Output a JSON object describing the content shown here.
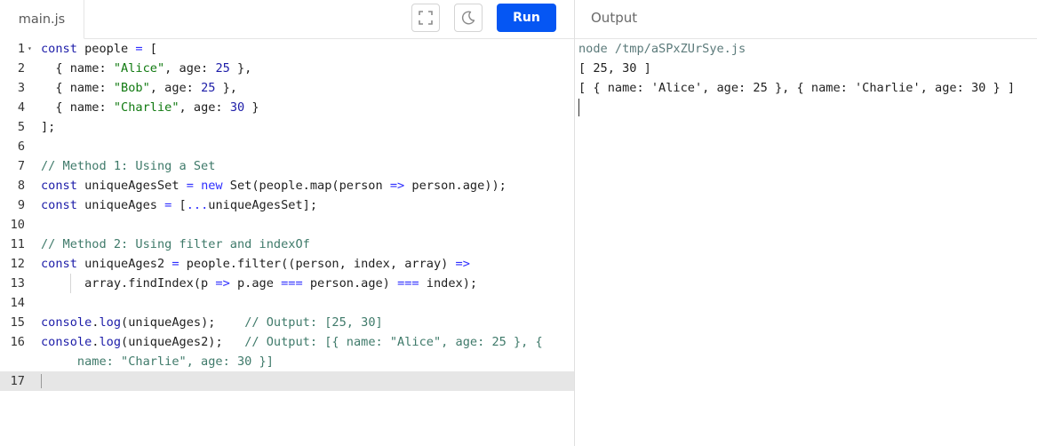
{
  "editor": {
    "file_tab": "main.js",
    "run_label": "Run",
    "icons": {
      "fullscreen": "fullscreen-icon",
      "theme": "moon-icon"
    }
  },
  "code_lines": [
    {
      "n": "1",
      "fold": true,
      "tokens": [
        [
          "kw",
          "const"
        ],
        [
          "punc",
          " people "
        ],
        [
          "op",
          "="
        ],
        [
          "punc",
          " ["
        ]
      ]
    },
    {
      "n": "2",
      "tokens": [
        [
          "punc",
          "  { name: "
        ],
        [
          "str",
          "\"Alice\""
        ],
        [
          "punc",
          ", age: "
        ],
        [
          "num",
          "25"
        ],
        [
          "punc",
          " },"
        ]
      ]
    },
    {
      "n": "3",
      "tokens": [
        [
          "punc",
          "  { name: "
        ],
        [
          "str",
          "\"Bob\""
        ],
        [
          "punc",
          ", age: "
        ],
        [
          "num",
          "25"
        ],
        [
          "punc",
          " },"
        ]
      ]
    },
    {
      "n": "4",
      "tokens": [
        [
          "punc",
          "  { name: "
        ],
        [
          "str",
          "\"Charlie\""
        ],
        [
          "punc",
          ", age: "
        ],
        [
          "num",
          "30"
        ],
        [
          "punc",
          " }"
        ]
      ]
    },
    {
      "n": "5",
      "tokens": [
        [
          "punc",
          "];"
        ]
      ]
    },
    {
      "n": "6",
      "tokens": []
    },
    {
      "n": "7",
      "tokens": [
        [
          "cmt",
          "// Method 1: Using a Set"
        ]
      ]
    },
    {
      "n": "8",
      "tokens": [
        [
          "kw",
          "const"
        ],
        [
          "punc",
          " uniqueAgesSet "
        ],
        [
          "op",
          "="
        ],
        [
          "punc",
          " "
        ],
        [
          "kwb",
          "new"
        ],
        [
          "punc",
          " Set(people.map(person "
        ],
        [
          "op",
          "=>"
        ],
        [
          "punc",
          " person.age));"
        ]
      ]
    },
    {
      "n": "9",
      "tokens": [
        [
          "kw",
          "const"
        ],
        [
          "punc",
          " uniqueAges "
        ],
        [
          "op",
          "="
        ],
        [
          "punc",
          " ["
        ],
        [
          "op",
          "..."
        ],
        [
          "punc",
          "uniqueAgesSet];"
        ]
      ]
    },
    {
      "n": "10",
      "tokens": []
    },
    {
      "n": "11",
      "tokens": [
        [
          "cmt",
          "// Method 2: Using filter and indexOf"
        ]
      ]
    },
    {
      "n": "12",
      "tokens": [
        [
          "kw",
          "const"
        ],
        [
          "punc",
          " uniqueAges2 "
        ],
        [
          "op",
          "="
        ],
        [
          "punc",
          " people.filter((person, index, array) "
        ],
        [
          "op",
          "=>"
        ]
      ]
    },
    {
      "n": "13",
      "guide": true,
      "tokens": [
        [
          "punc",
          "      array.findIndex(p "
        ],
        [
          "op",
          "=>"
        ],
        [
          "punc",
          " p.age "
        ],
        [
          "op",
          "==="
        ],
        [
          "punc",
          " person.age) "
        ],
        [
          "op",
          "==="
        ],
        [
          "punc",
          " index);"
        ]
      ]
    },
    {
      "n": "14",
      "tokens": []
    },
    {
      "n": "15",
      "tokens": [
        [
          "kw",
          "console"
        ],
        [
          "punc",
          "."
        ],
        [
          "kw",
          "log"
        ],
        [
          "punc",
          "(uniqueAges);    "
        ],
        [
          "cmt",
          "// Output: [25, 30]"
        ]
      ]
    },
    {
      "n": "16",
      "tokens": [
        [
          "kw",
          "console"
        ],
        [
          "punc",
          "."
        ],
        [
          "kw",
          "log"
        ],
        [
          "punc",
          "(uniqueAges2);   "
        ],
        [
          "cmt",
          "// Output: [{ name: \"Alice\", age: 25 }, {"
        ]
      ]
    },
    {
      "n": "",
      "tokens": [
        [
          "cmt",
          "     name: \"Charlie\", age: 30 }]"
        ]
      ]
    },
    {
      "n": "17",
      "active": true,
      "tokens": []
    }
  ],
  "output": {
    "title": "Output",
    "lines": [
      "node /tmp/aSPxZUrSye.js",
      "[ 25, 30 ]",
      "[ { name: 'Alice', age: 25 }, { name: 'Charlie', age: 30 } ]"
    ]
  }
}
